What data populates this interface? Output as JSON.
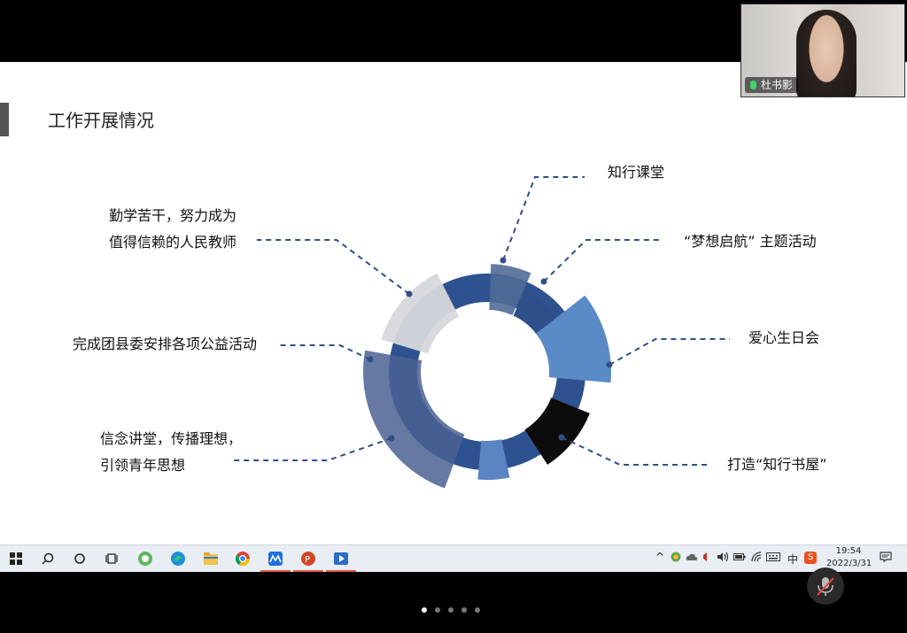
{
  "slide": {
    "title": "工作开展情况",
    "labels": {
      "item_1": "知行课堂",
      "item_2": "“梦想启航” 主题活动",
      "item_3": "爱心生日会",
      "item_4": "打造“知行书屋”",
      "item_5_line1": "信念讲堂，传播理想，",
      "item_5_line2": "引领青年思想",
      "item_6": "完成团县委安排各项公益活动",
      "item_7_line1": "勤学苦干，努力成为",
      "item_7_line2": "值得信赖的人民教师"
    }
  },
  "colors": {
    "inner_ring": "#2e5290",
    "segment_item_1": "#4f6b96",
    "segment_item_2": "#2e4f8a",
    "segment_item_3": "#5b8bc6",
    "segment_item_4": "#0c0c0c",
    "segment_item_5": "#5a84c2",
    "segment_item_6": "#4a6293",
    "segment_item_7": "#d6d8dc",
    "leader_line": "#2f4f86"
  },
  "video": {
    "participant_name": "杜书影"
  },
  "taskbar": {
    "icons": [
      "windows-start-icon",
      "search-icon",
      "cortana-icon",
      "task-view-icon",
      "app-green-icon",
      "edge-icon",
      "file-explorer-icon",
      "chrome-icon",
      "meeting-app-icon",
      "powerpoint-icon",
      "media-player-icon"
    ],
    "tray": {
      "chevron": "^",
      "ime": "中",
      "ime_s": "S"
    },
    "clock_time": "19:54",
    "clock_date": "2022/3/31"
  },
  "pager": {
    "count": 5,
    "active": 1
  }
}
